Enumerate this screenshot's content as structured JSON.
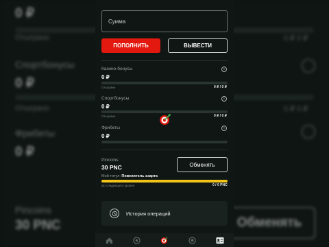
{
  "background": {
    "amount_top": "0 ₽",
    "wagered_label": "Отыграно",
    "wagered_right": "0 ₽ 0 ₽",
    "sportbonus_label": "Спортбонусы",
    "sportbonus_amount": "0 ₽",
    "wagered_label_2": "Отыграно",
    "wagered_right_2": "0 ₽ 0 ₽",
    "freebets_label": "Фрибеты",
    "freebets_amount": "0 ₽",
    "pincoins_label": "Pincoins",
    "pincoins_amount": "30 PNC",
    "exchange_label": "Обменять"
  },
  "wallet": {
    "amount_placeholder": "Сумма",
    "deposit_label": "ПОПОЛНИТЬ",
    "withdraw_label": "ВЫВЕСТИ"
  },
  "bonuses": {
    "casino": {
      "label": "Казино-бонусы",
      "amount": "0 ₽",
      "wagered_label": "Отыграно",
      "wagered_value": "0 ₽ / 0 ₽",
      "progress": 0
    },
    "sport": {
      "label": "Спортбонусы",
      "amount": "0 ₽",
      "wagered_label": "Отыграно",
      "wagered_value": "0 ₽ / 0 ₽",
      "progress": 0
    },
    "freebets": {
      "label": "Фрибеты",
      "amount": "0 ₽",
      "progress": 0
    }
  },
  "rewards": {
    "label": "Pincoins",
    "amount": "30 PNC",
    "exchange_label": "Обменять",
    "title_prefix": "Мой титул:",
    "title_value": "Повелитель азарта",
    "next_level_label": "До следующего уровня",
    "next_level_value": "0 / 0 PNC",
    "progress": 1.0
  },
  "history": {
    "label": "История операций",
    "icon": "history-icon"
  },
  "nav": {
    "items": [
      {
        "icon": "home-icon"
      },
      {
        "icon": "casino-chip-icon"
      },
      {
        "icon": "target-icon",
        "active": true
      },
      {
        "icon": "sport-ball-icon"
      },
      {
        "icon": "profile-card-icon",
        "active": true
      }
    ]
  },
  "colors": {
    "accent_red": "#e3190f",
    "progress_yellow": "#f2c318",
    "panel_bg": "#0f1613",
    "target_green": "#3fb34f"
  }
}
